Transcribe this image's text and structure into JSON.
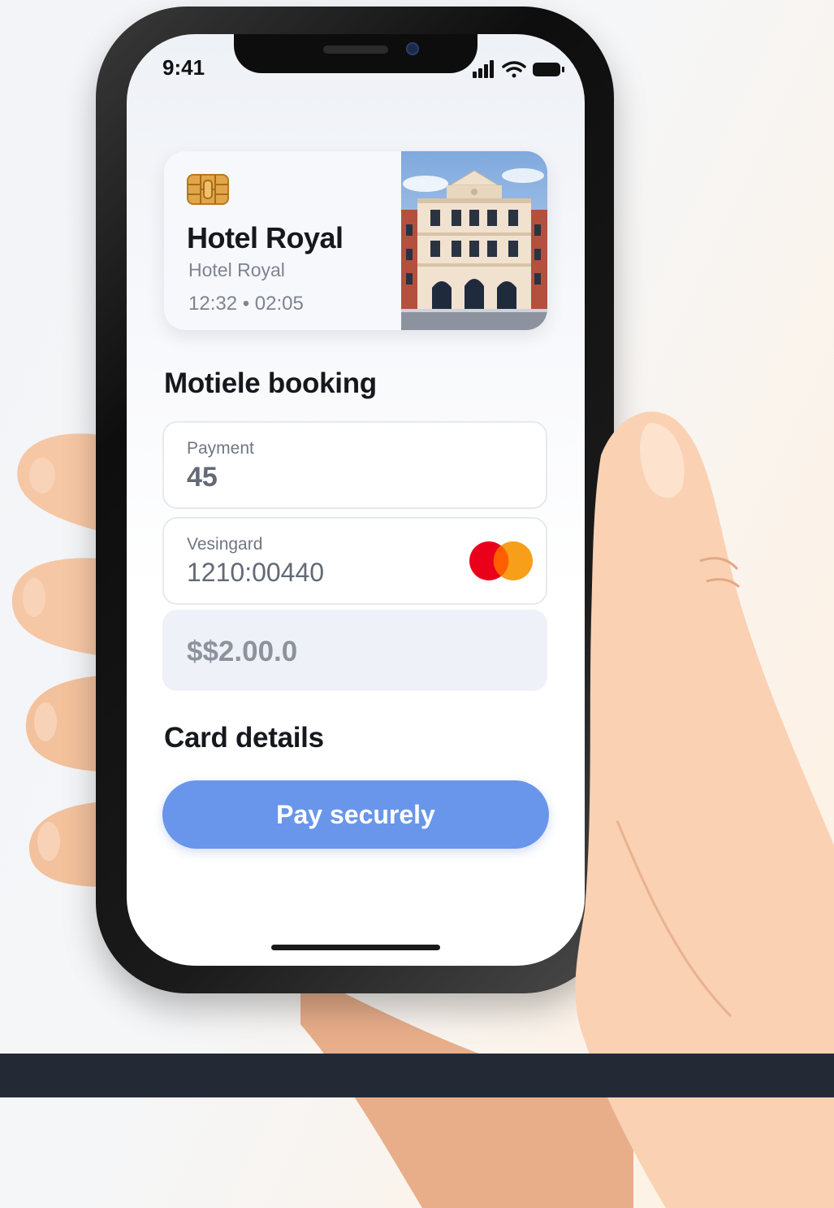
{
  "status_bar": {
    "time": "9:41"
  },
  "hotel_card": {
    "name": "Hotel Royal",
    "subtitle": "Hotel Royal",
    "time_range": "12:32 • 02:05"
  },
  "booking": {
    "title": "Motiele booking",
    "payment_field": {
      "label": "Payment",
      "value": "45"
    },
    "card_field": {
      "label": "Vesingard",
      "value": "1210:00440",
      "brand_icon": "mastercard-logo-icon"
    },
    "amount_field": {
      "value": "$$2.00.0"
    }
  },
  "card_details": {
    "title": "Card details",
    "pay_button_label": "Pay securely"
  },
  "colors": {
    "accent": "#6996ea",
    "dark_bar": "#232a36",
    "mastercard_red": "#eb001b",
    "mastercard_orange": "#f79e1b"
  }
}
